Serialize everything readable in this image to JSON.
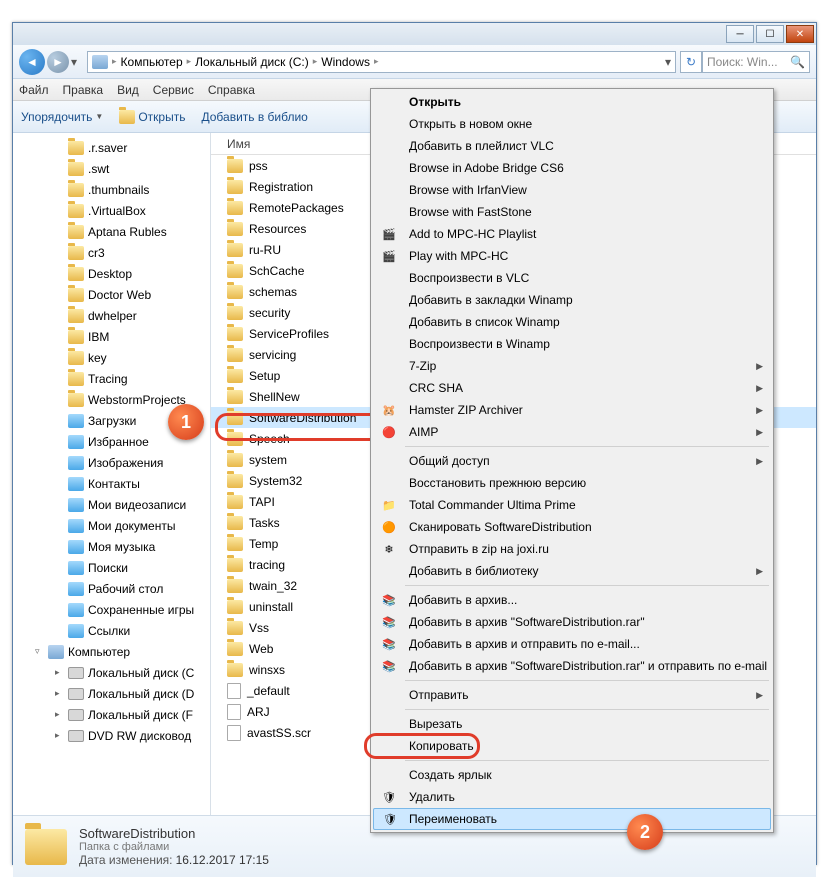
{
  "titlebar": {
    "min": "─",
    "max": "☐",
    "close": "✕"
  },
  "breadcrumb": {
    "seg1": "Компьютер",
    "seg2": "Локальный диск (C:)",
    "seg3": "Windows"
  },
  "search": {
    "placeholder": "Поиск: Win..."
  },
  "menubar": {
    "file": "Файл",
    "edit": "Правка",
    "view": "Вид",
    "tools": "Сервис",
    "help": "Справка"
  },
  "toolbar": {
    "organize": "Упорядочить",
    "open": "Открыть",
    "addlib": "Добавить в библио"
  },
  "tree": [
    {
      "label": ".r.saver",
      "ico": "folder",
      "lvl": 2
    },
    {
      "label": ".swt",
      "ico": "folder",
      "lvl": 2
    },
    {
      "label": ".thumbnails",
      "ico": "folder",
      "lvl": 2
    },
    {
      "label": ".VirtualBox",
      "ico": "folder",
      "lvl": 2
    },
    {
      "label": "Aptana Rubles",
      "ico": "folder",
      "lvl": 2
    },
    {
      "label": "cr3",
      "ico": "folder",
      "lvl": 2
    },
    {
      "label": "Desktop",
      "ico": "folder",
      "lvl": 2
    },
    {
      "label": "Doctor Web",
      "ico": "folder",
      "lvl": 2
    },
    {
      "label": "dwhelper",
      "ico": "folder",
      "lvl": 2
    },
    {
      "label": "IBM",
      "ico": "folder",
      "lvl": 2
    },
    {
      "label": "key",
      "ico": "folder",
      "lvl": 2
    },
    {
      "label": "Tracing",
      "ico": "folder",
      "lvl": 2
    },
    {
      "label": "WebstormProjects",
      "ico": "folder",
      "lvl": 2
    },
    {
      "label": "Загрузки",
      "ico": "special",
      "lvl": 2
    },
    {
      "label": "Избранное",
      "ico": "special",
      "lvl": 2
    },
    {
      "label": "Изображения",
      "ico": "special",
      "lvl": 2
    },
    {
      "label": "Контакты",
      "ico": "special",
      "lvl": 2
    },
    {
      "label": "Мои видеозаписи",
      "ico": "special",
      "lvl": 2
    },
    {
      "label": "Мои документы",
      "ico": "special",
      "lvl": 2
    },
    {
      "label": "Моя музыка",
      "ico": "special",
      "lvl": 2
    },
    {
      "label": "Поиски",
      "ico": "special",
      "lvl": 2
    },
    {
      "label": "Рабочий стол",
      "ico": "special",
      "lvl": 2
    },
    {
      "label": "Сохраненные игры",
      "ico": "special",
      "lvl": 2
    },
    {
      "label": "Ссылки",
      "ico": "special",
      "lvl": 2
    },
    {
      "label": "Компьютер",
      "ico": "comp",
      "lvl": 1,
      "exp": "▿"
    },
    {
      "label": "Локальный диск (C",
      "ico": "drive",
      "lvl": 2,
      "exp": "▸"
    },
    {
      "label": "Локальный диск (D",
      "ico": "drive",
      "lvl": 2,
      "exp": "▸"
    },
    {
      "label": "Локальный диск (F",
      "ico": "drive",
      "lvl": 2,
      "exp": "▸"
    },
    {
      "label": "DVD RW дисковод",
      "ico": "drive",
      "lvl": 2,
      "exp": "▸"
    }
  ],
  "list_header": "Имя",
  "list": [
    {
      "label": "pss",
      "ico": "folder"
    },
    {
      "label": "Registration",
      "ico": "folder"
    },
    {
      "label": "RemotePackages",
      "ico": "folder"
    },
    {
      "label": "Resources",
      "ico": "folder"
    },
    {
      "label": "ru-RU",
      "ico": "folder"
    },
    {
      "label": "SchCache",
      "ico": "folder"
    },
    {
      "label": "schemas",
      "ico": "folder"
    },
    {
      "label": "security",
      "ico": "folder"
    },
    {
      "label": "ServiceProfiles",
      "ico": "folder"
    },
    {
      "label": "servicing",
      "ico": "folder"
    },
    {
      "label": "Setup",
      "ico": "folder"
    },
    {
      "label": "ShellNew",
      "ico": "folder"
    },
    {
      "label": "SoftwareDistribution",
      "ico": "folder",
      "selected": true
    },
    {
      "label": "Speech",
      "ico": "folder"
    },
    {
      "label": "system",
      "ico": "folder"
    },
    {
      "label": "System32",
      "ico": "folder"
    },
    {
      "label": "TAPI",
      "ico": "folder"
    },
    {
      "label": "Tasks",
      "ico": "folder"
    },
    {
      "label": "Temp",
      "ico": "folder"
    },
    {
      "label": "tracing",
      "ico": "folder"
    },
    {
      "label": "twain_32",
      "ico": "folder"
    },
    {
      "label": "uninstall",
      "ico": "folder"
    },
    {
      "label": "Vss",
      "ico": "folder"
    },
    {
      "label": "Web",
      "ico": "folder"
    },
    {
      "label": "winsxs",
      "ico": "folder"
    },
    {
      "label": "_default",
      "ico": "file"
    },
    {
      "label": "ARJ",
      "ico": "file"
    },
    {
      "label": "avastSS.scr",
      "ico": "file"
    }
  ],
  "ctx": [
    {
      "label": "Открыть",
      "bold": true
    },
    {
      "label": "Открыть в новом окне"
    },
    {
      "label": "Добавить в плейлист VLC"
    },
    {
      "label": "Browse in Adobe Bridge CS6"
    },
    {
      "label": "Browse with IrfanView"
    },
    {
      "label": "Browse with FastStone"
    },
    {
      "label": "Add to MPC-HC Playlist",
      "icon": "🎬"
    },
    {
      "label": "Play with MPC-HC",
      "icon": "🎬"
    },
    {
      "label": "Воспроизвести в VLC"
    },
    {
      "label": "Добавить в закладки Winamp"
    },
    {
      "label": "Добавить в список Winamp"
    },
    {
      "label": "Воспроизвести в Winamp"
    },
    {
      "label": "7-Zip",
      "sub": true
    },
    {
      "label": "CRC SHA",
      "sub": true
    },
    {
      "label": "Hamster ZIP Archiver",
      "icon": "🐹",
      "sub": true
    },
    {
      "label": "AIMP",
      "icon": "🔴",
      "sub": true
    },
    {
      "sep": true
    },
    {
      "label": "Общий доступ",
      "sub": true
    },
    {
      "label": "Восстановить прежнюю версию"
    },
    {
      "label": "Total Commander Ultima Prime",
      "icon": "📁"
    },
    {
      "label": "Сканировать SoftwareDistribution",
      "icon": "🟠"
    },
    {
      "label": "Отправить в zip на joxi.ru",
      "icon": "❄"
    },
    {
      "label": "Добавить в библиотеку",
      "sub": true
    },
    {
      "sep": true
    },
    {
      "label": "Добавить в архив...",
      "icon": "📚"
    },
    {
      "label": "Добавить в архив \"SoftwareDistribution.rar\"",
      "icon": "📚"
    },
    {
      "label": "Добавить в архив и отправить по e-mail...",
      "icon": "📚"
    },
    {
      "label": "Добавить в архив \"SoftwareDistribution.rar\" и отправить по e-mail",
      "icon": "📚"
    },
    {
      "sep": true
    },
    {
      "label": "Отправить",
      "sub": true
    },
    {
      "sep": true
    },
    {
      "label": "Вырезать"
    },
    {
      "label": "Копировать"
    },
    {
      "sep": true
    },
    {
      "label": "Создать ярлык"
    },
    {
      "label": "Удалить",
      "icon": "🛡"
    },
    {
      "label": "Переименовать",
      "icon": "🛡",
      "hover": true
    }
  ],
  "details": {
    "title": "SoftwareDistribution",
    "type": "Папка с файлами",
    "date_label": "Дата изменения:",
    "date_value": "16.12.2017 17:15"
  },
  "badges": {
    "b1": "1",
    "b2": "2"
  }
}
